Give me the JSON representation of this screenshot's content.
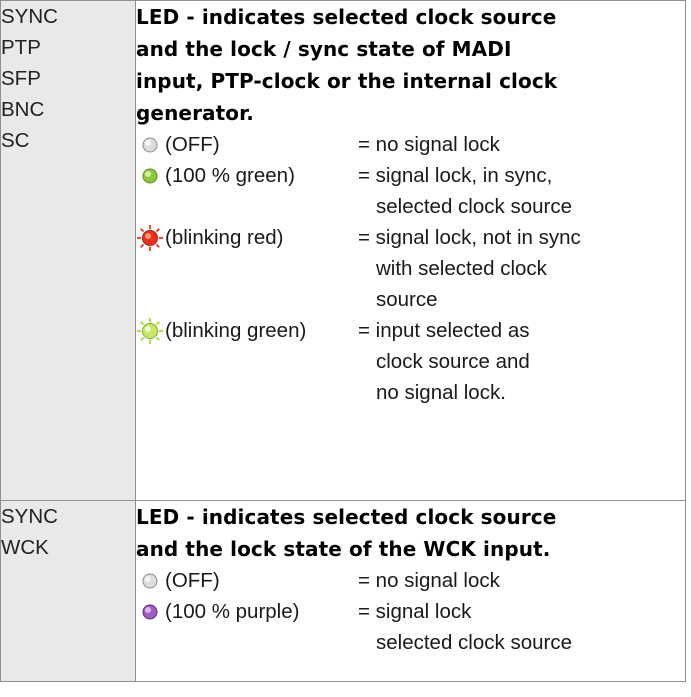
{
  "rows": [
    {
      "labels": [
        "SYNC",
        "PTP",
        "SFP",
        "BNC",
        "SC"
      ],
      "heading": [
        "LED - indicates selected clock source",
        "and the lock / sync state of MADI",
        "input, PTP-clock or the internal clock",
        "generator."
      ],
      "states": [
        {
          "led": "led-off-icon",
          "state": "(OFF)",
          "meaning": [
            "= no signal lock"
          ]
        },
        {
          "led": "led-green-icon",
          "state": "(100 % green)",
          "meaning": [
            "= signal lock, in sync,",
            "selected clock source"
          ]
        },
        {
          "led": "led-blinking-red-icon",
          "state": "(blinking red)",
          "meaning": [
            "= signal lock, not in sync",
            "with selected clock",
            "source"
          ]
        },
        {
          "led": "led-blinking-green-icon",
          "state": "(blinking green)",
          "meaning": [
            "= input selected as",
            "clock source and",
            "no signal lock."
          ]
        }
      ]
    },
    {
      "labels": [
        "SYNC",
        "WCK"
      ],
      "heading": [
        "LED - indicates selected clock source",
        "and the lock state of the WCK input."
      ],
      "states": [
        {
          "led": "led-off-icon",
          "state": "(OFF)",
          "meaning": [
            "= no signal lock"
          ]
        },
        {
          "led": "led-purple-icon",
          "state": "(100 % purple)",
          "meaning": [
            "= signal lock",
            "selected clock source"
          ]
        }
      ]
    }
  ],
  "colors": {
    "off": "#d9d9d9",
    "green": "#8ec63f",
    "red": "#e8321e",
    "blinking_green": "#c9e86a",
    "purple": "#a05cc0",
    "label_bg": "#e9e9e9"
  }
}
